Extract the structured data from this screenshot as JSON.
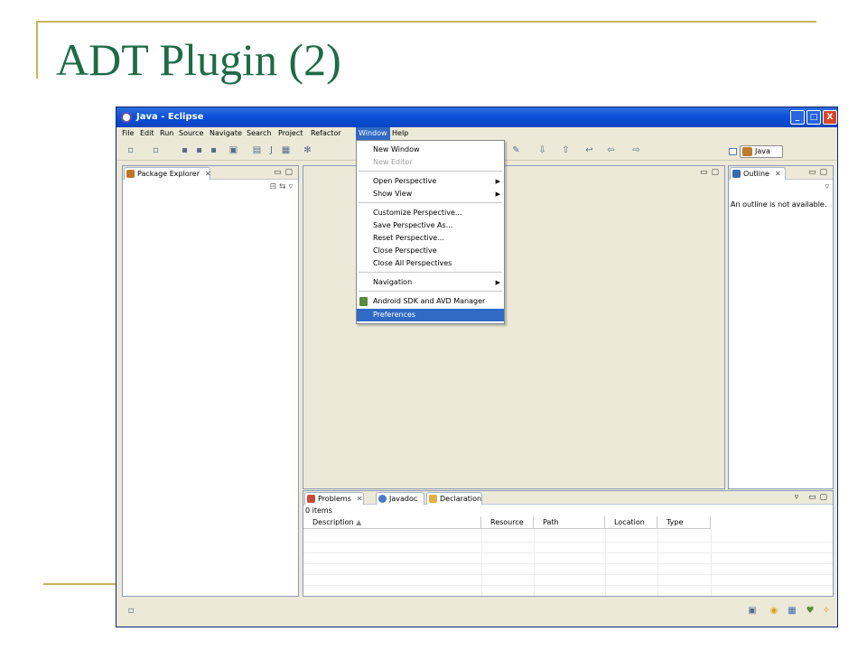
{
  "slide": {
    "title": "ADT Plugin (2)"
  },
  "window": {
    "title": "Java - Eclipse",
    "buttons": {
      "minimize": "_",
      "maximize": "□",
      "close": "X"
    }
  },
  "menubar": {
    "items": [
      "File",
      "Edit",
      "Run",
      "Source",
      "Navigate",
      "Search",
      "Project",
      "Refactor",
      "Window",
      "Help"
    ],
    "active": "Window"
  },
  "toolbar": {
    "perspective_label": "Java"
  },
  "package_explorer": {
    "tab_label": "Package Explorer",
    "close_glyph": "✕"
  },
  "outline": {
    "tab_label": "Outline",
    "close_glyph": "✕",
    "message": "An outline is not available."
  },
  "window_menu": {
    "items": [
      {
        "label": "New Window",
        "enabled": true
      },
      {
        "label": "New Editor",
        "enabled": false
      },
      {
        "label": "Open Perspective",
        "submenu": true
      },
      {
        "label": "Show View",
        "submenu": true
      },
      {
        "label": "Customize Perspective..."
      },
      {
        "label": "Save Perspective As..."
      },
      {
        "label": "Reset Perspective..."
      },
      {
        "label": "Close Perspective"
      },
      {
        "label": "Close All Perspectives"
      },
      {
        "label": "Navigation",
        "submenu": true
      },
      {
        "label": "Android SDK and AVD Manager",
        "icon": "android-icon"
      },
      {
        "label": "Preferences",
        "selected": true
      }
    ],
    "submenu_arrow": "▶"
  },
  "bottom_panel": {
    "tabs": [
      "Problems",
      "Javadoc",
      "Declaration"
    ],
    "close_glyph": "✕",
    "items_count": "0 items",
    "columns": [
      "Description",
      "Resource",
      "Path",
      "Location",
      "Type"
    ],
    "sort_indicator": "▲"
  },
  "colors": {
    "accent": "#316ac5",
    "slide_title": "#1f6b46",
    "slide_lines": "#c8b45a",
    "titlebar": "#0a50d8"
  }
}
